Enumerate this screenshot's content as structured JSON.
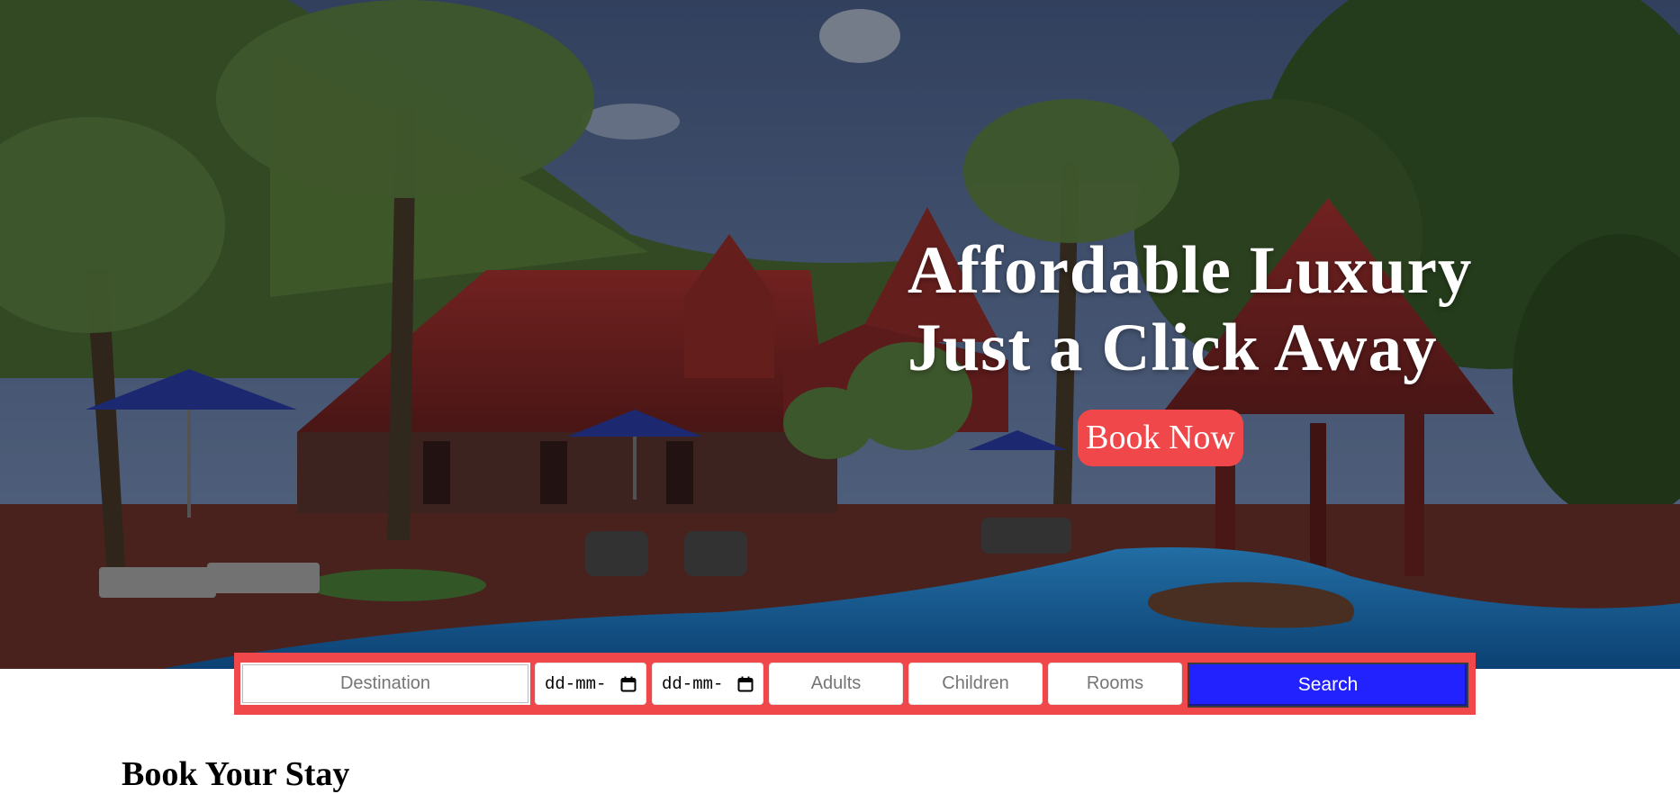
{
  "hero": {
    "headline_line1": "Affordable Luxury",
    "headline_line2": "Just a Click Away",
    "book_now_label": "Book Now",
    "image_subject": "resort-pool-with-palm-trees-and-red-tiled-roofs"
  },
  "search": {
    "destination_placeholder": "Destination",
    "checkin_value": "dd-mm-",
    "checkout_value": "dd-mm-",
    "adults_placeholder": "Adults",
    "children_placeholder": "Children",
    "rooms_placeholder": "Rooms",
    "search_label": "Search"
  },
  "section": {
    "title": "Book Your Stay"
  },
  "colors": {
    "accent": "#f0474a",
    "search_button": "#2222ff",
    "headline_text": "#ffffff"
  },
  "icons": {
    "date_picker": "calendar-icon"
  }
}
